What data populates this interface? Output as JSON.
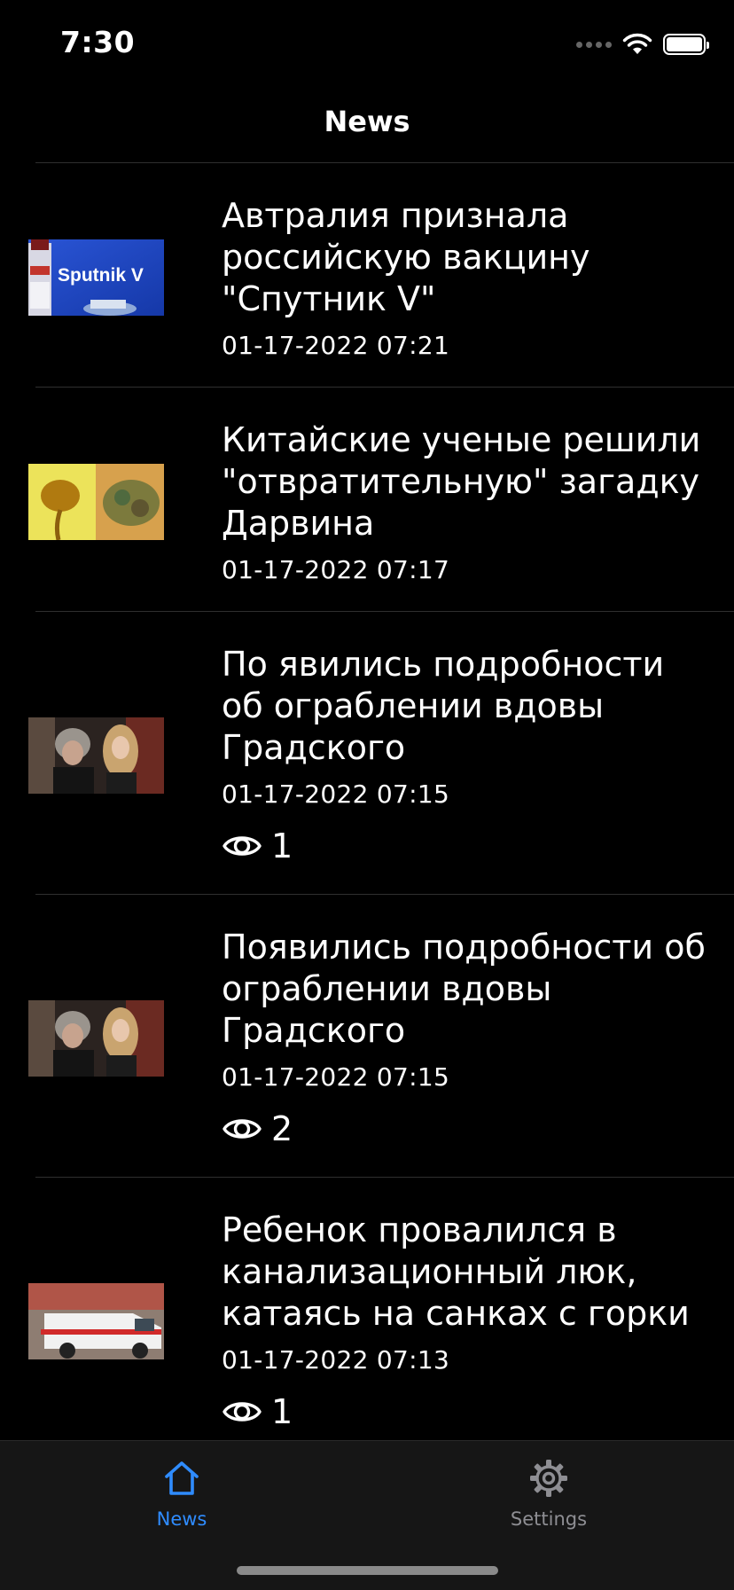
{
  "status": {
    "time": "7:30",
    "battery_level": 1.0
  },
  "nav": {
    "title": "News"
  },
  "accent": "#2f8cff",
  "inactive_tab_color": "#8e8e93",
  "articles": [
    {
      "title": "Автралия признала российскую вакцину \"Спутник V\"",
      "date": "01-17-2022 07:21",
      "views": null,
      "thumb": "sputnik"
    },
    {
      "title": "Китайские ученые решили \"отвратительную\" загадку Дарвина",
      "date": "01-17-2022 07:17",
      "views": null,
      "thumb": "darwin"
    },
    {
      "title": "По явились подробности об ограблении вдовы Градского",
      "date": "01-17-2022 07:15",
      "views": "1",
      "thumb": "gradsky"
    },
    {
      "title": "Появились подробности об ограблении вдовы Градского",
      "date": "01-17-2022 07:15",
      "views": "2",
      "thumb": "gradsky"
    },
    {
      "title": "Ребенок провалился в канализационный люк, катаясь на санках с горки",
      "date": "01-17-2022 07:13",
      "views": "1",
      "thumb": "ambulance"
    }
  ],
  "thumb_text": {
    "sputnik": "Sputnik V"
  },
  "tabs": {
    "news": {
      "label": "News",
      "icon": "house-icon",
      "active": true
    },
    "settings": {
      "label": "Settings",
      "icon": "gear-icon",
      "active": false
    }
  }
}
